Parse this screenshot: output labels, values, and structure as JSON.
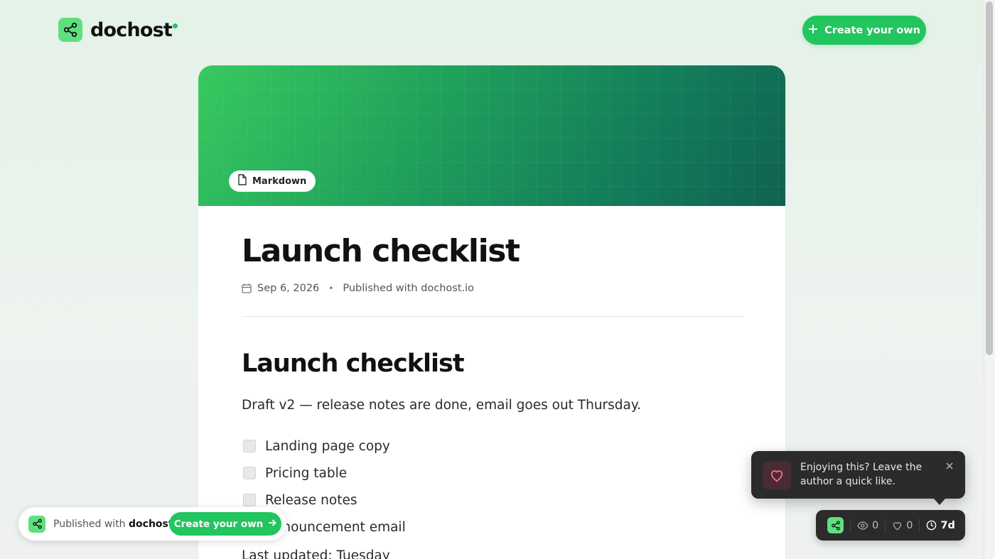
{
  "header": {
    "brand": "dochost",
    "cta_label": "Create your own"
  },
  "document": {
    "format_badge": "Markdown",
    "title": "Launch checklist",
    "date": "Sep 6, 2026",
    "published_with": "Published with dochost.io",
    "body": {
      "heading": "Launch checklist",
      "paragraph": "Draft v2 — release notes are done, email goes out Thursday.",
      "checklist": [
        {
          "label": "Landing page copy",
          "checked": true
        },
        {
          "label": "Pricing table",
          "checked": true
        },
        {
          "label": "Release notes",
          "checked": true
        },
        {
          "label": "Announcement email",
          "checked": false
        }
      ],
      "last_updated": "Last updated: Tuesday"
    }
  },
  "footer_pill": {
    "prefix": "Published with",
    "brand": "dochost",
    "cta_label": "Create your own"
  },
  "toast": {
    "message": "Enjoying this? Leave the author a quick like."
  },
  "stats": {
    "views": "0",
    "likes": "0",
    "expires": "7d"
  },
  "colors": {
    "accent": "#22c55e",
    "logo_bg": "#5ee07e",
    "dark_panel": "#2b2b2b"
  },
  "icons": [
    "share-nodes-icon",
    "plus-icon",
    "file-icon",
    "calendar-icon",
    "heart-icon",
    "close-icon",
    "eye-icon",
    "clock-icon",
    "arrow-right-icon"
  ]
}
